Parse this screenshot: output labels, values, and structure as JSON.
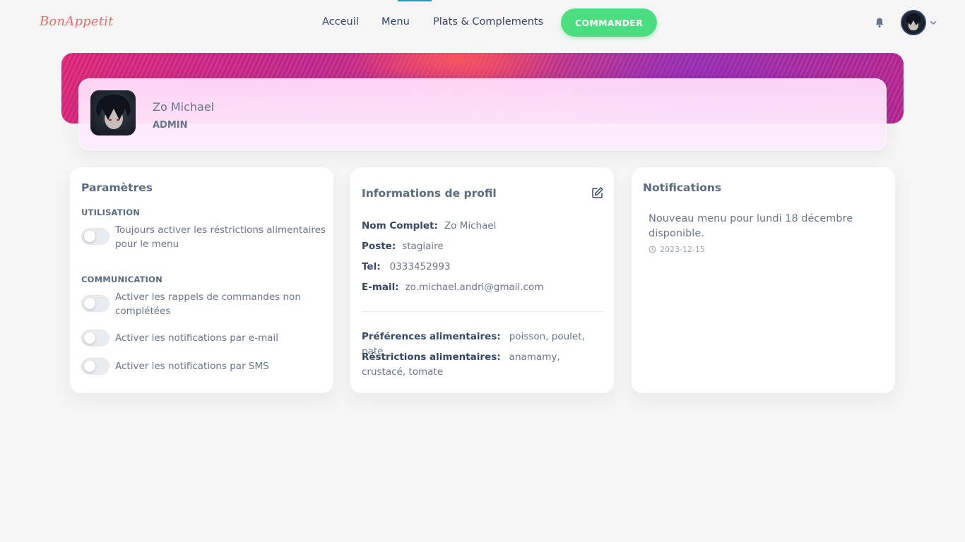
{
  "brand": "BonAppetit",
  "nav": {
    "links": [
      "Acceuil",
      "Menu",
      "Plats & Complements"
    ],
    "order_button": "COMMANDER"
  },
  "profile": {
    "name": "Zo Michael",
    "role": "ADMIN"
  },
  "settings": {
    "title": "Paramètres",
    "usage_label": "UTILISATION",
    "usage_toggle": "Toujours activer les réstrictions alimentaires pour le menu",
    "communication_label": "COMMUNICATION",
    "comm_toggles": [
      "Activer les rappels de commandes non complétées",
      "Activer les notifications par e-mail",
      "Activer les notifications par SMS"
    ]
  },
  "profile_info": {
    "title": "Informations de profil",
    "fields": [
      {
        "key": "Nom Complet:",
        "value": "Zo Michael"
      },
      {
        "key": "Poste:",
        "value": "stagiaire"
      },
      {
        "key": "Tel:",
        "value": "0333452993"
      },
      {
        "key": "E-mail:",
        "value": "zo.michael.andri@gmail.com"
      }
    ],
    "preferences": {
      "key": "Préférences alimentaires:",
      "value": "poisson, poulet, pate"
    },
    "restrictions": {
      "key": "Réstrictions alimentaires:",
      "value": "anamamy, crustacé, tomate"
    }
  },
  "notifications": {
    "title": "Notifications",
    "items": [
      {
        "text": "Nouveau menu pour lundi 18 décembre disponible.",
        "date": "2023-12-15"
      }
    ]
  },
  "icons": {
    "bell": "bell-icon",
    "edit": "edit-icon",
    "clock": "clock-icon",
    "chevron": "chevron-down-icon"
  },
  "colors": {
    "accent_green": "#4ade80",
    "brand_red": "#e86a6a",
    "nav_indicator": "#17a2b8"
  }
}
